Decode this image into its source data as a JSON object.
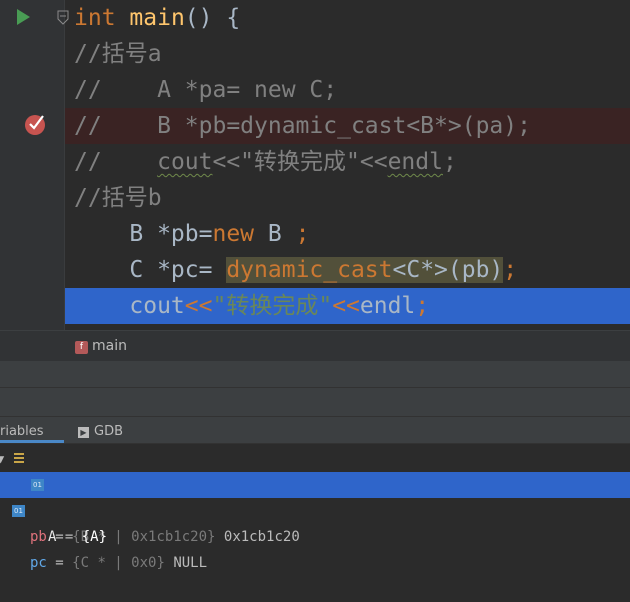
{
  "editor": {
    "lines": [
      {
        "parts": [
          {
            "t": "int",
            "c": "kw"
          },
          {
            "t": " ",
            "c": ""
          },
          {
            "t": "main",
            "c": "fn"
          },
          {
            "t": "() {",
            "c": ""
          }
        ]
      },
      {
        "parts": [
          {
            "t": "//括号a",
            "c": "comment"
          }
        ]
      },
      {
        "parts": [
          {
            "t": "//    A *pa= new C;",
            "c": "comment"
          }
        ]
      },
      {
        "parts": [
          {
            "t": "//    B *pb=dynamic_cast<B*>(pa);",
            "c": "comment"
          }
        ]
      },
      {
        "parts": [
          {
            "t": "//    ",
            "c": "comment"
          },
          {
            "t": "cout",
            "c": "comment squiggle"
          },
          {
            "t": "<<\"转换完成\"<<",
            "c": "comment"
          },
          {
            "t": "endl",
            "c": "comment squiggle"
          },
          {
            "t": ";",
            "c": "comment"
          }
        ]
      },
      {
        "parts": [
          {
            "t": "//括号b",
            "c": "comment"
          }
        ]
      },
      {
        "parts": [
          {
            "t": "    B *pb=",
            "c": ""
          },
          {
            "t": "new",
            "c": "kw"
          },
          {
            "t": " B ",
            "c": ""
          },
          {
            "t": ";",
            "c": "kw"
          }
        ]
      },
      {
        "parts": [
          {
            "t": "    C *pc= ",
            "c": ""
          },
          {
            "t": "dynamic_cast",
            "c": "hl"
          },
          {
            "t": "<C*>(pb)",
            "c": "hlplain"
          },
          {
            "t": ";",
            "c": "kw"
          }
        ]
      },
      {
        "parts": [
          {
            "t": "    cout",
            "c": ""
          },
          {
            "t": "<<",
            "c": "kw"
          },
          {
            "t": "\"转换完成\"",
            "c": "str"
          },
          {
            "t": "<<",
            "c": "kw"
          },
          {
            "t": "endl",
            "c": ""
          },
          {
            "t": ";",
            "c": "kw"
          }
        ]
      }
    ]
  },
  "breadcrumb": {
    "badge": "f",
    "label": "main"
  },
  "debug": {
    "tabs": [
      {
        "label": "riables"
      },
      {
        "label": "GDB",
        "icon_text": "▶"
      }
    ],
    "variables": [
      {
        "name": "pb",
        "type_info": "{B * | 0x1cb1c20}",
        "value": "0x1cb1c20",
        "expanded": true
      },
      {
        "name": "A",
        "icon_text": "01",
        "type_info": "{A}",
        "value": "",
        "selected": true
      },
      {
        "name": "pc",
        "icon_text": "01",
        "type_info": "{C * | 0x0}",
        "value": "NULL"
      }
    ]
  },
  "colors": {
    "keyword": "#cc7832",
    "function": "#ffc66d",
    "string": "#6a8759",
    "comment": "#808080",
    "selection": "#2f65ca",
    "breakpoint_line": "#3a2323"
  }
}
